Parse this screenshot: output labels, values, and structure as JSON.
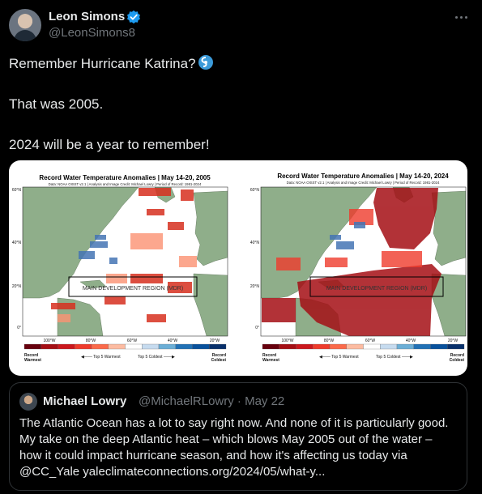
{
  "author": {
    "name": "Leon Simons",
    "handle": "@LeonSimons8"
  },
  "tweet": {
    "line1": "Remember Hurricane Katrina?",
    "line2": "That was 2005.",
    "line3": "2024 will be a year to remember!"
  },
  "media": {
    "left": {
      "title": "Record Water Temperature Anomalies | May 14-20, 2005",
      "subtitle": "Data: NOAA OISST v2.1 | Analysis and Image Credit: Michael Lowry | Period of Record: 1981-2024",
      "region_label": "MAIN DEVELOPMENT REGION (MDR)"
    },
    "right": {
      "title": "Record Water Temperature Anomalies | May 14-20, 2024",
      "subtitle": "Data: NOAA OISST v2.1 | Analysis and Image Credit: Michael Lowry | Period of Record: 1981-2024",
      "region_label": "MAIN DEVELOPMENT REGION (MDR)"
    },
    "lat_labels": [
      "60°N",
      "40°N",
      "20°N",
      "0°"
    ],
    "lon_labels": [
      "100°W",
      "80°W",
      "60°W",
      "40°W",
      "20°W"
    ],
    "legend": {
      "record_warmest": "Record Warmest",
      "top5_warmest": "Top 5 Warmest",
      "top5_coldest": "Top 5 Coldest",
      "record_coldest": "Record Coldest"
    },
    "legend_colors": [
      "#67000d",
      "#a50f15",
      "#cb181d",
      "#ef3b2c",
      "#fb6a4a",
      "#fcbba1",
      "#ffffff",
      "#c6dbef",
      "#6baed6",
      "#2171b5",
      "#08519c",
      "#08306b"
    ]
  },
  "quote": {
    "name": "Michael Lowry",
    "handle": "@MichaelRLowry · May 22",
    "text": "The Atlantic Ocean has a lot to say right now. And none of it is particularly good. My take on the deep Atlantic heat – which blows May 2005 out of the water – how it could impact hurricane season, and how it's affecting us today via @CC_Yale yaleclimateconnections.org/2024/05/what-y..."
  },
  "icons": {
    "verified": "verified-badge-icon",
    "hurricane": "cyclone-emoji-icon",
    "more": "more-options-icon"
  },
  "colors": {
    "background": "#000000",
    "text": "#e7e9ea",
    "secondary": "#71767b",
    "verified": "#1d9bf0",
    "border": "#2f3336",
    "land": "#8fae8a"
  }
}
